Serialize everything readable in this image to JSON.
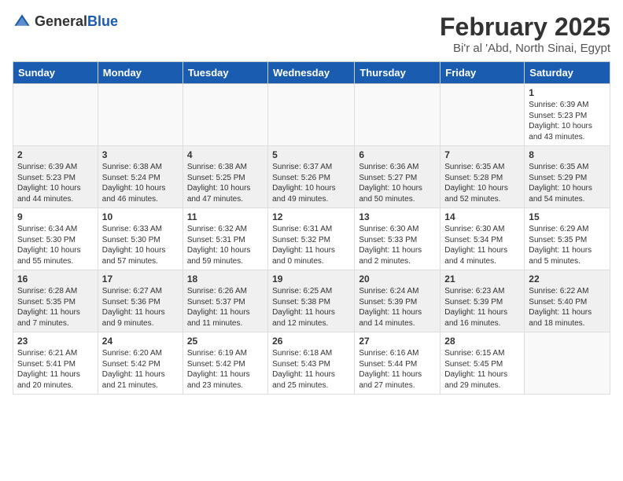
{
  "logo": {
    "general": "General",
    "blue": "Blue"
  },
  "title": {
    "month": "February 2025",
    "location": "Bi'r al 'Abd, North Sinai, Egypt"
  },
  "days_of_week": [
    "Sunday",
    "Monday",
    "Tuesday",
    "Wednesday",
    "Thursday",
    "Friday",
    "Saturday"
  ],
  "weeks": [
    {
      "shaded": false,
      "days": [
        {
          "num": "",
          "info": ""
        },
        {
          "num": "",
          "info": ""
        },
        {
          "num": "",
          "info": ""
        },
        {
          "num": "",
          "info": ""
        },
        {
          "num": "",
          "info": ""
        },
        {
          "num": "",
          "info": ""
        },
        {
          "num": "1",
          "info": "Sunrise: 6:39 AM\nSunset: 5:23 PM\nDaylight: 10 hours and 43 minutes."
        }
      ]
    },
    {
      "shaded": true,
      "days": [
        {
          "num": "2",
          "info": "Sunrise: 6:39 AM\nSunset: 5:23 PM\nDaylight: 10 hours and 44 minutes."
        },
        {
          "num": "3",
          "info": "Sunrise: 6:38 AM\nSunset: 5:24 PM\nDaylight: 10 hours and 46 minutes."
        },
        {
          "num": "4",
          "info": "Sunrise: 6:38 AM\nSunset: 5:25 PM\nDaylight: 10 hours and 47 minutes."
        },
        {
          "num": "5",
          "info": "Sunrise: 6:37 AM\nSunset: 5:26 PM\nDaylight: 10 hours and 49 minutes."
        },
        {
          "num": "6",
          "info": "Sunrise: 6:36 AM\nSunset: 5:27 PM\nDaylight: 10 hours and 50 minutes."
        },
        {
          "num": "7",
          "info": "Sunrise: 6:35 AM\nSunset: 5:28 PM\nDaylight: 10 hours and 52 minutes."
        },
        {
          "num": "8",
          "info": "Sunrise: 6:35 AM\nSunset: 5:29 PM\nDaylight: 10 hours and 54 minutes."
        }
      ]
    },
    {
      "shaded": false,
      "days": [
        {
          "num": "9",
          "info": "Sunrise: 6:34 AM\nSunset: 5:30 PM\nDaylight: 10 hours and 55 minutes."
        },
        {
          "num": "10",
          "info": "Sunrise: 6:33 AM\nSunset: 5:30 PM\nDaylight: 10 hours and 57 minutes."
        },
        {
          "num": "11",
          "info": "Sunrise: 6:32 AM\nSunset: 5:31 PM\nDaylight: 10 hours and 59 minutes."
        },
        {
          "num": "12",
          "info": "Sunrise: 6:31 AM\nSunset: 5:32 PM\nDaylight: 11 hours and 0 minutes."
        },
        {
          "num": "13",
          "info": "Sunrise: 6:30 AM\nSunset: 5:33 PM\nDaylight: 11 hours and 2 minutes."
        },
        {
          "num": "14",
          "info": "Sunrise: 6:30 AM\nSunset: 5:34 PM\nDaylight: 11 hours and 4 minutes."
        },
        {
          "num": "15",
          "info": "Sunrise: 6:29 AM\nSunset: 5:35 PM\nDaylight: 11 hours and 5 minutes."
        }
      ]
    },
    {
      "shaded": true,
      "days": [
        {
          "num": "16",
          "info": "Sunrise: 6:28 AM\nSunset: 5:35 PM\nDaylight: 11 hours and 7 minutes."
        },
        {
          "num": "17",
          "info": "Sunrise: 6:27 AM\nSunset: 5:36 PM\nDaylight: 11 hours and 9 minutes."
        },
        {
          "num": "18",
          "info": "Sunrise: 6:26 AM\nSunset: 5:37 PM\nDaylight: 11 hours and 11 minutes."
        },
        {
          "num": "19",
          "info": "Sunrise: 6:25 AM\nSunset: 5:38 PM\nDaylight: 11 hours and 12 minutes."
        },
        {
          "num": "20",
          "info": "Sunrise: 6:24 AM\nSunset: 5:39 PM\nDaylight: 11 hours and 14 minutes."
        },
        {
          "num": "21",
          "info": "Sunrise: 6:23 AM\nSunset: 5:39 PM\nDaylight: 11 hours and 16 minutes."
        },
        {
          "num": "22",
          "info": "Sunrise: 6:22 AM\nSunset: 5:40 PM\nDaylight: 11 hours and 18 minutes."
        }
      ]
    },
    {
      "shaded": false,
      "days": [
        {
          "num": "23",
          "info": "Sunrise: 6:21 AM\nSunset: 5:41 PM\nDaylight: 11 hours and 20 minutes."
        },
        {
          "num": "24",
          "info": "Sunrise: 6:20 AM\nSunset: 5:42 PM\nDaylight: 11 hours and 21 minutes."
        },
        {
          "num": "25",
          "info": "Sunrise: 6:19 AM\nSunset: 5:42 PM\nDaylight: 11 hours and 23 minutes."
        },
        {
          "num": "26",
          "info": "Sunrise: 6:18 AM\nSunset: 5:43 PM\nDaylight: 11 hours and 25 minutes."
        },
        {
          "num": "27",
          "info": "Sunrise: 6:16 AM\nSunset: 5:44 PM\nDaylight: 11 hours and 27 minutes."
        },
        {
          "num": "28",
          "info": "Sunrise: 6:15 AM\nSunset: 5:45 PM\nDaylight: 11 hours and 29 minutes."
        },
        {
          "num": "",
          "info": ""
        }
      ]
    }
  ]
}
